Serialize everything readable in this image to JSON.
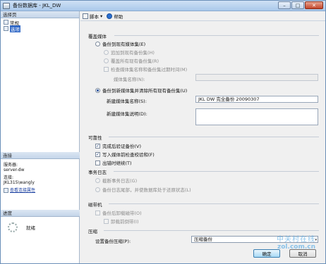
{
  "window": {
    "title": "备份数据库 - JKL_DW",
    "minimize": "–",
    "maximize": "□",
    "close": "✕"
  },
  "sidebar": {
    "pages_header": "选择页",
    "pages": [
      {
        "label": "常规"
      },
      {
        "label": "选项"
      }
    ],
    "connection_header": "连接",
    "server_label": "服务器:",
    "server_value": "server-dw",
    "connection_label": "连接:",
    "connection_value": "JKL315\\wangly",
    "view_connection_link": "查看连接属性",
    "progress_header": "进度",
    "progress_status": "就绪"
  },
  "toolbar": {
    "script_label": "脚本",
    "help_label": "帮助",
    "dropdown_glyph": "▾"
  },
  "overwrite_media": {
    "title": "覆盖媒体",
    "existing_set_option": "备份到现有媒体集(E)",
    "append_option": "追加到现有备份集(H)",
    "overwrite_option": "覆盖所有现有备份集(R)",
    "check_name_option": "检查媒体集名称和备份集过期时间(M)",
    "media_set_name_label": "媒体集名称(N):",
    "new_set_option": "备份到新媒体集并清除所有现有备份集(U)",
    "new_set_name_label": "新建媒体集名称(S):",
    "new_set_name_value": "JKL DW 完全备份 20090307",
    "new_set_desc_label": "新建媒体集说明(D):"
  },
  "reliability": {
    "title": "可靠性",
    "verify_option": "完成后验证备份(V)",
    "checksum_option": "写入媒体前检查校验和(F)",
    "continue_on_error_option": "出错时继续(T)"
  },
  "transaction_log": {
    "title": "事务日志",
    "truncate_option": "截断事务日志(G)",
    "tail_option": "备份日志尾部，并使数据库处于还原状态(L)"
  },
  "tape_drive": {
    "title": "磁带机",
    "unload_option": "备份后卸载磁带(O)",
    "rewind_option": "卸载前倒带(I)"
  },
  "compression": {
    "title": "压缩",
    "setting_label": "设置备份压缩(P):",
    "selected_value": "压缩备份"
  },
  "footer": {
    "ok_label": "确定",
    "cancel_label": "取消"
  },
  "watermark": {
    "cn": "中关村在线",
    "en": "zol.com.cn"
  }
}
